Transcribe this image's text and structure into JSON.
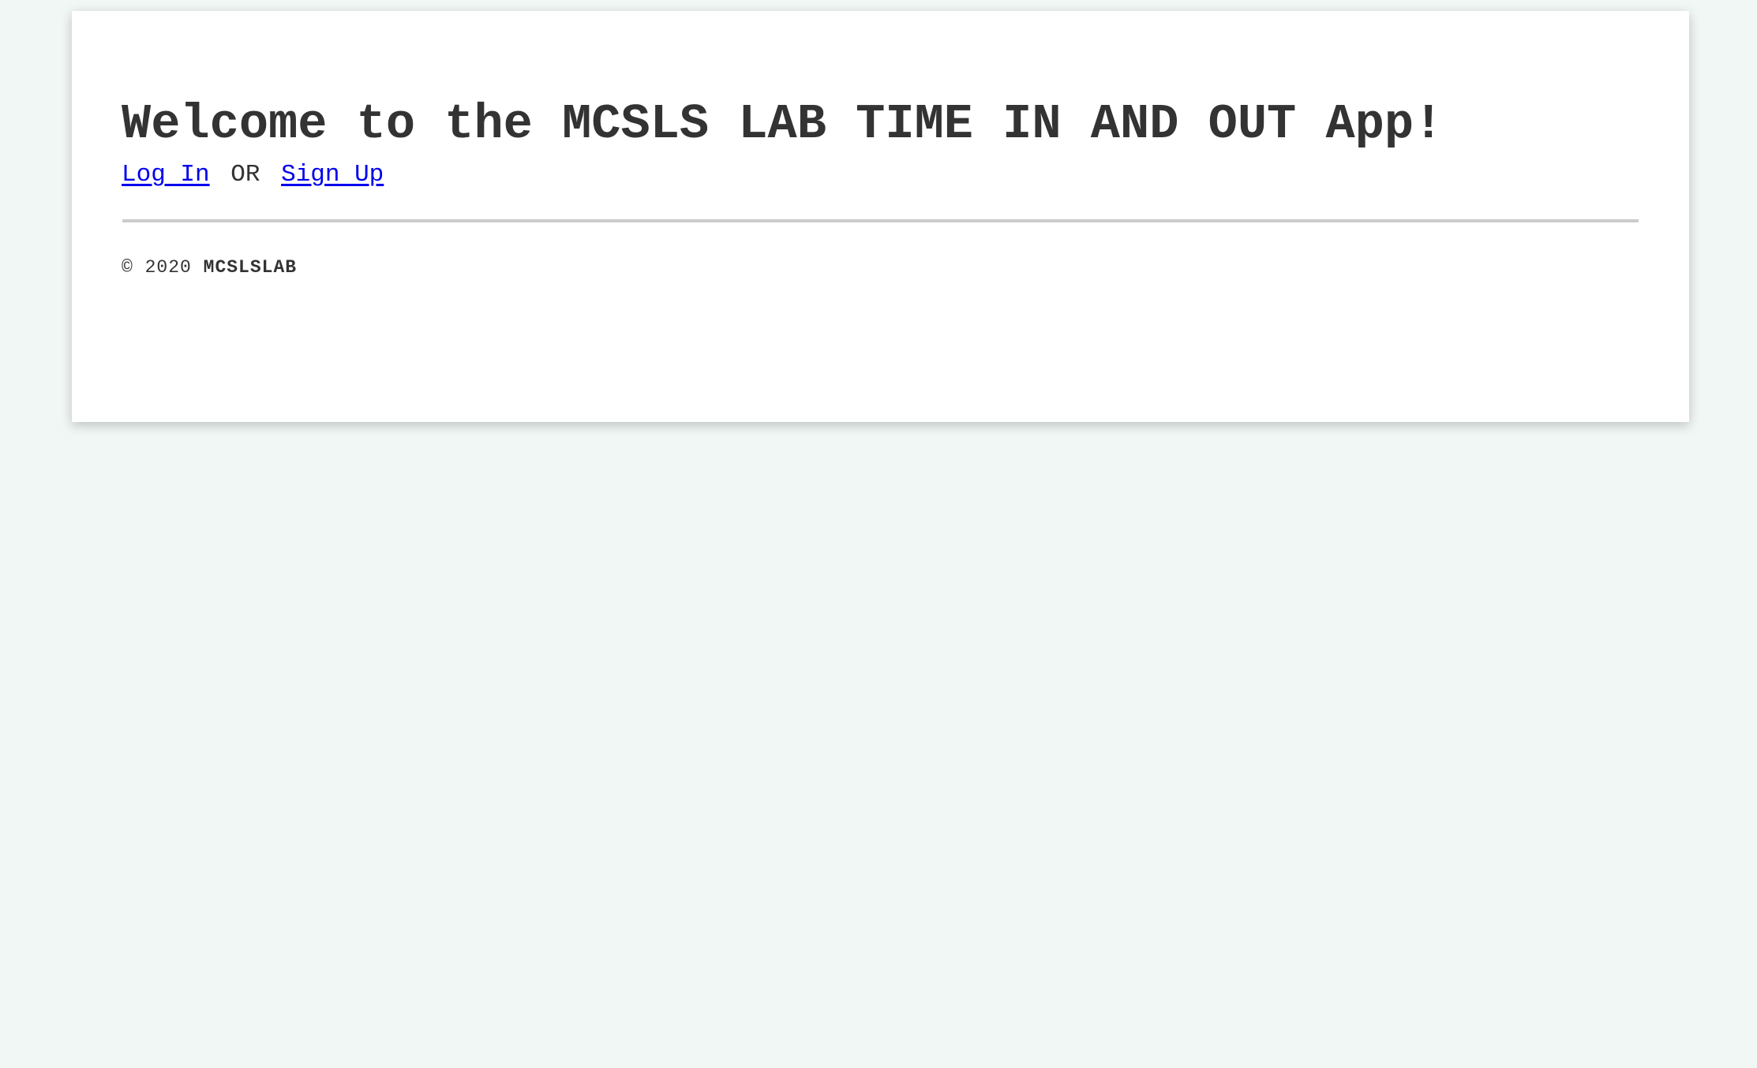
{
  "header": {
    "title": "Welcome to the MCSLS LAB TIME IN AND OUT App!"
  },
  "auth": {
    "login_label": "Log In",
    "separator": "OR",
    "signup_label": "Sign Up",
    "link_color": "#0000ee"
  },
  "footer": {
    "copyright": "© 2020",
    "brand": "MCSLSLAB"
  },
  "theme": {
    "background": "#f1f7f5",
    "card": "#ffffff",
    "text": "#333333",
    "divider": "#cccccc"
  }
}
